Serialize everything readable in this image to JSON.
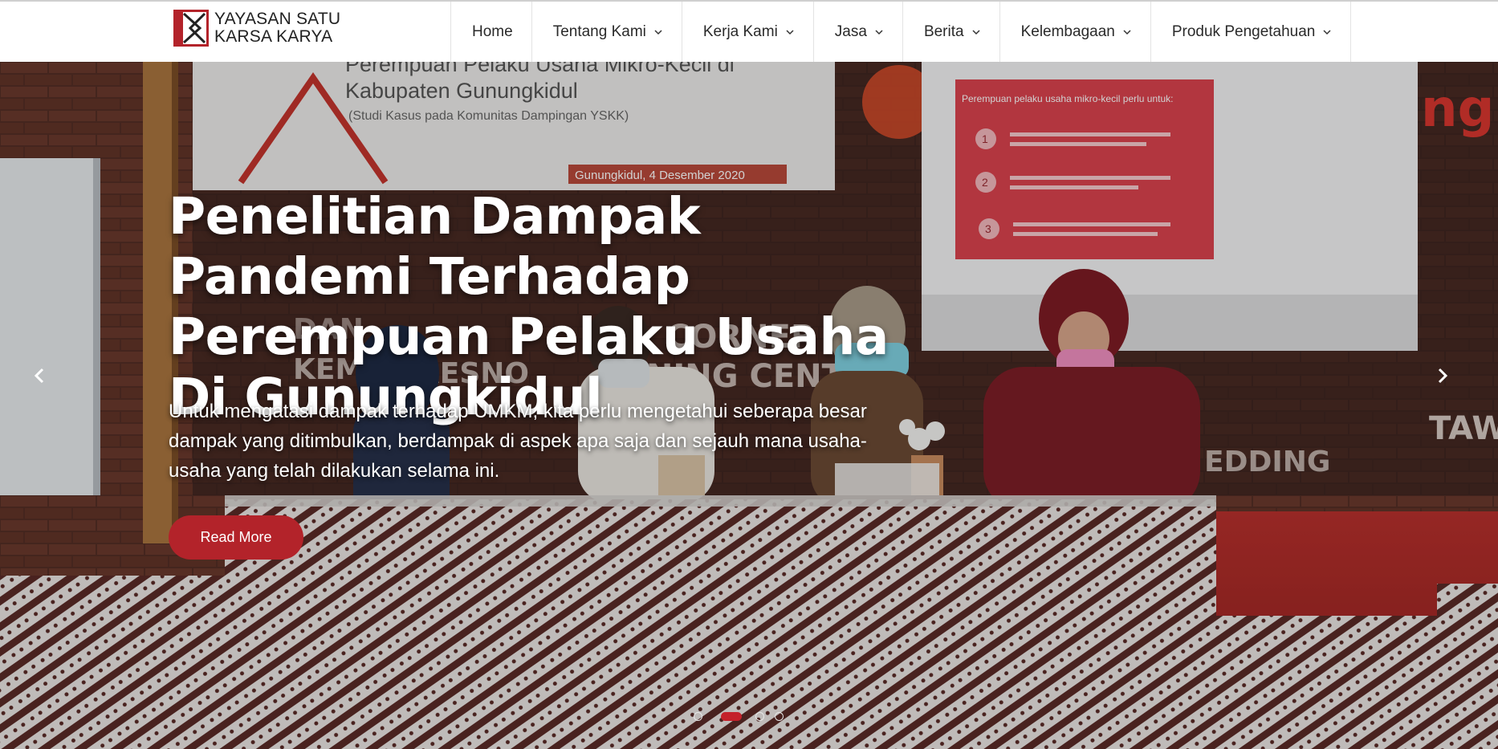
{
  "brand": {
    "line1": "YAYASAN SATU",
    "line2": "KARSA KARYA",
    "accent_color": "#b3232a"
  },
  "nav": {
    "items": [
      {
        "label": "Home",
        "has_dropdown": false
      },
      {
        "label": "Tentang Kami",
        "has_dropdown": true
      },
      {
        "label": "Kerja Kami",
        "has_dropdown": true
      },
      {
        "label": "Jasa",
        "has_dropdown": true
      },
      {
        "label": "Berita",
        "has_dropdown": true
      },
      {
        "label": "Kelembagaan",
        "has_dropdown": true
      },
      {
        "label": "Produk Pengetahuan",
        "has_dropdown": true
      }
    ]
  },
  "hero": {
    "title": "Penelitian Dampak Pandemi Terhadap Perempuan Pelaku Usaha Di Gunungkidul",
    "description": "Untuk mengatasi dampak terhadap UMKM, kita perlu mengetahui seberapa besar dampak yang ditimbulkan, berdampak di aspek apa saja dan sejauh mana usaha-usaha yang telah dilakukan selama ini.",
    "button_label": "Read More",
    "button_color": "#b3232a",
    "prev_icon": "chevron-left-icon",
    "next_icon": "chevron-right-icon",
    "slides_total": 4,
    "active_slide": 2
  },
  "photo": {
    "banner_line1": "Perempuan Pelaku Usaha Mikro-Kecil di",
    "banner_line2": "Kabupaten Gunungkidul",
    "banner_line3": "(Studi Kasus pada Komunitas Dampingan YSKK)",
    "banner_date": "Gunungkidul, 4 Desember 2020",
    "screen_heading": "Perempuan pelaku usaha mikro-kecil perlu untuk:",
    "screen_numbers": [
      "1",
      "2",
      "3"
    ],
    "wall_text_1": "CORNER +",
    "wall_text_2": "INING CENTER",
    "wall_text_3": "KEMBU",
    "wall_text_4": "RESNO",
    "wall_text_5": "TAWA",
    "wall_text_6": "EDDING",
    "wall_text_7": "DAN",
    "wall_text_8": "ng"
  }
}
